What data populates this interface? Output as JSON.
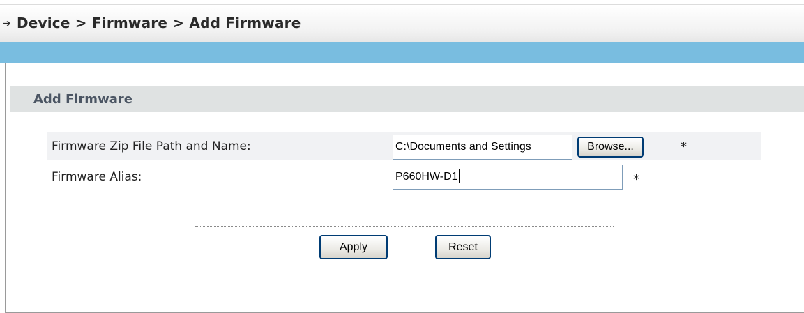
{
  "breadcrumb": {
    "text": "Device > Firmware > Add Firmware"
  },
  "section": {
    "title": "Add Firmware"
  },
  "form": {
    "file": {
      "label": "Firmware Zip File Path and Name:",
      "value": "C:\\Documents and Settings",
      "browse_label": "Browse...",
      "required_mark": "*"
    },
    "alias": {
      "label": "Firmware Alias:",
      "value": "P660HW-D1",
      "required_mark": "*"
    }
  },
  "actions": {
    "apply_label": "Apply",
    "reset_label": "Reset"
  },
  "colors": {
    "band_blue": "#79bde0",
    "section_header_bg": "#dfe2e2",
    "row_highlight_bg": "#f1f2f4",
    "button_border": "#003c74"
  },
  "icons": {
    "breadcrumb_prefix": "arrow-right-icon"
  }
}
